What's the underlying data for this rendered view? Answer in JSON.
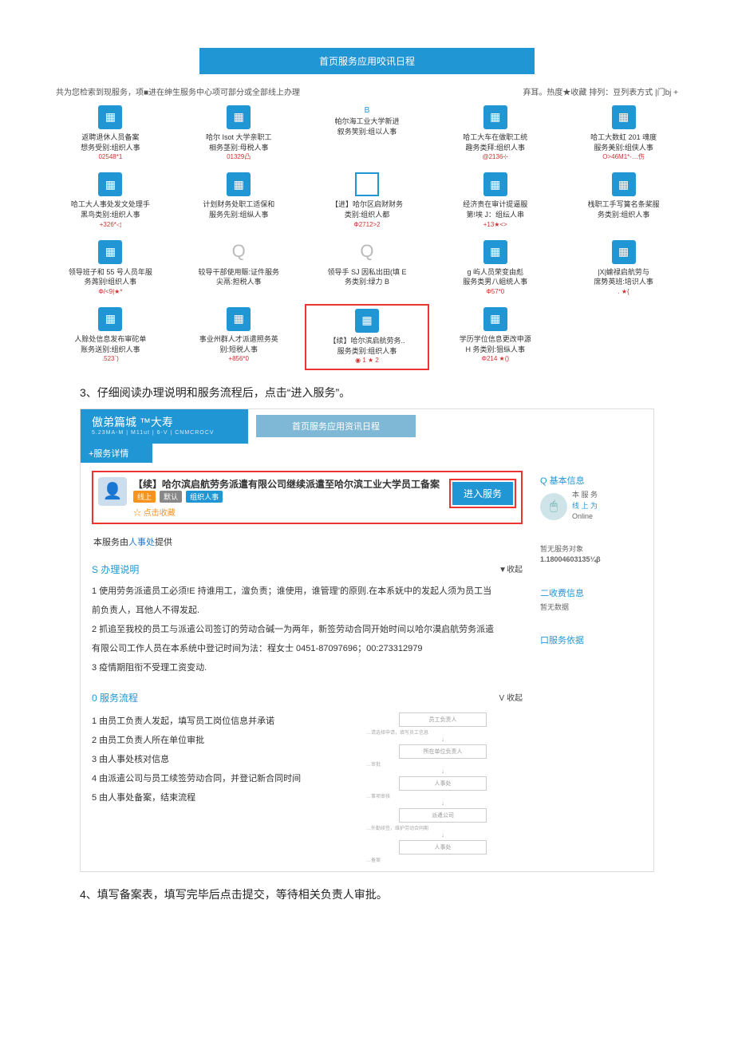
{
  "banner1": "首页服务应用咬讯日程",
  "subhead_left": "共为您检索到现服务，项■进在绅生服务中心项可部分或全部线上办理",
  "subhead_right": "弃耳。热度★收藏 排列：豆列表方式 |门bj +",
  "cards": [
    {
      "type": "icon",
      "t1": "返聘退休人员备案",
      "t2": "想务受别:组织人事",
      "meta": "02548*1"
    },
    {
      "type": "icon",
      "t1": "哈尔 Isot 大学亲职工",
      "t2": "相务茎别:母税人事",
      "meta": "01329凸"
    },
    {
      "type": "sep",
      "label": "B",
      "t1": "帕尔海工业大学新进",
      "t2": "叙务笑别:组以人事"
    },
    {
      "type": "icon",
      "t1": "哈工大车在做职工统",
      "t2": "趣务类拜:组织人事",
      "meta": "@2136⊹"
    },
    {
      "type": "icon",
      "t1": "哈工大数虹 201 魂度",
      "t2": "服务美别:组侠人事",
      "meta": "O>46M1*-…伤"
    },
    {
      "type": "icon",
      "t1": "哈工大人事处发文处理手",
      "t2": "黑鸟类别:组织人事",
      "meta": "+326*◁"
    },
    {
      "type": "icon",
      "t1": "计划财务处职工适保和",
      "t2": "服务先别:组纵人事"
    },
    {
      "type": "box",
      "t1": "【进】哈尔区启财财务",
      "t2": "类别:组织人都",
      "meta": "Φ2712>2"
    },
    {
      "type": "icon",
      "t1": "经济责在审计提逼服",
      "t2": "第!埃 J：组纭人串",
      "meta": "+13★<>"
    },
    {
      "type": "icon",
      "t1": "栈职工手写簧名条桨服",
      "t2": "务类别:组织人事"
    },
    {
      "type": "icon",
      "t1": "领导班子和 55 号人员年服",
      "t2": "务荛别!组织人事",
      "meta": "Φ/<9|★*"
    },
    {
      "type": "letter",
      "letter": "Q",
      "t1": "较导干部使用赈:证件服务",
      "t2": "尖鬲:担税人事"
    },
    {
      "type": "letter",
      "letter": "Q",
      "t1": "领导手 SJ 因私出田(填 E",
      "t2": "务类别:绿力 B"
    },
    {
      "type": "icon",
      "t1": "g 屿人员荣变由彪",
      "t2": "服务类男八組统人事",
      "meta": "Φ57*0"
    },
    {
      "type": "icon",
      "t1": "|X|蝓禄启航劳与",
      "t2": "席势英班:培识人事",
      "meta": ". ★{"
    },
    {
      "type": "icon",
      "t1": "人赊处信息发布审砣单",
      "t2": "账务送别:组织人事",
      "meta": ".523`)"
    },
    {
      "type": "icon",
      "t1": "事业州群人才派遣照务英",
      "t2": "别:短税人事",
      "meta": "+856*0"
    },
    {
      "type": "icon",
      "hl": true,
      "t1": "【续】哈尔滨启航劳务..",
      "t2": "服务类别:组织人事",
      "meta": "◉ 1  ★ 2"
    },
    {
      "type": "icon",
      "t1": "学历学位信息更改申源",
      "t2": "H 务类别:狙纵人事",
      "meta": "Φ214 ★()"
    }
  ],
  "step3": "3、仔细阅读办理说明和服务流程后，点击“进入服务”。",
  "logo_main": "傲弟篇城 ™大寿",
  "logo_sub": "5.23MA-M | M11ut | 6-V | CNMCROCV",
  "tabs_text": "首页服务应用资讯日程",
  "subtab": "+服务详情",
  "svc_title": "【续】哈尔滨启航劳务派遣有限公司继续派遣至哈尔滨工业大学员工备案",
  "tags": {
    "online": "线上",
    "default": "默认",
    "org": "组织人事"
  },
  "fav": "☆ 点击收藏",
  "enter_btn": "进入服务",
  "provider_pre": "本服务由",
  "provider_link": "人事处",
  "provider_post": "提供",
  "sec_process_title": "S 办理说明",
  "collapse": "▼收起",
  "p1": "1 使用劳务派遣员工必须!E 持谁用工，澶负责；谁使用，谁管理’的原则.在本系妩中的发起人须为员工当",
  "p1b": "前负责人，耳他人不得发起.",
  "p2": "2 抓追至我校的员工与派遣公司签订的劳动合碱一为两年，新签劳动合同开始时间以哈尔漠启航劳务派遣",
  "p2b": "有限公司工作人员在本系统中登记时间为法：程女士 0451-87097696；00:273312979",
  "p3": "3 疫情期阻衔不受理工资变动.",
  "sec_flow_title": "0 服务流程",
  "collapse2": "V 收起",
  "f1": "1 由员工负责人发起，填写员工岗位信息并承诺",
  "f2": "2 由员工负责人所在单位审批",
  "f3": "3 由人事处核对信息",
  "f4": "4 由派遣公司与员工续签劳动合同，并登记新合同时间",
  "f5": "5 由人事处备案，结束流程",
  "flow_nodes": [
    "员工负责人",
    "所在单位负责人",
    "人事处",
    "派遣公司",
    "人事处"
  ],
  "flow_lbls": [
    "…请选择申请，填写员工信息",
    "…审批",
    "…事项审核",
    "…外勤续签，维护劳动合同期",
    "…备案"
  ],
  "side_basic": "Q 基本信息",
  "side_svc1": "本 服 务",
  "side_svc2": "线 上 为",
  "side_svc3": "Online",
  "side_noobj": "暂无服务对象",
  "side_ver": "1.18004603135¼β",
  "side_fee": "二收费信息",
  "side_nodata": "暂无数据",
  "side_basis": "口服务依据",
  "step4": "4、填写备案表，填写完毕后点击提交，等待相关负责人审批。"
}
